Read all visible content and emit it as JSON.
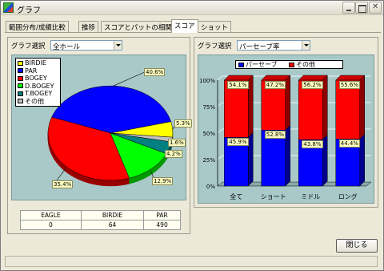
{
  "window": {
    "title": "グラフ"
  },
  "tabs": [
    {
      "label": "範囲分布/成績比較",
      "active": false
    },
    {
      "label": "推移",
      "active": false
    },
    {
      "label": "スコアとパットの相関",
      "active": false
    },
    {
      "label": "スコア",
      "active": true
    },
    {
      "label": "ショット",
      "active": false
    }
  ],
  "left_panel": {
    "select_label": "グラフ選択",
    "select_value": "全ホール"
  },
  "right_panel": {
    "select_label": "グラフ選択",
    "select_value": "パーセーブ率"
  },
  "score_table": {
    "headers": [
      "EAGLE",
      "BIRDIE",
      "PAR"
    ],
    "values": [
      "0",
      "64",
      "490"
    ]
  },
  "close_button": "閉じる",
  "chart_data": [
    {
      "type": "pie",
      "categories": [
        "BIRDIE",
        "PAR",
        "BOGEY",
        "D.BOGEY",
        "T.BOGEY",
        "その他"
      ],
      "values": [
        5.3,
        40.6,
        35.4,
        12.9,
        4.2,
        1.6
      ],
      "labels": [
        "5.3%",
        "40.6%",
        "35.4%",
        "12.9%",
        "4.2%",
        "1.6%"
      ],
      "colors": [
        "#ffff00",
        "#0000ff",
        "#ff0000",
        "#00ff00",
        "#008080",
        "#c0c0c0"
      ],
      "legend": "top-left"
    },
    {
      "type": "bar",
      "stacked": true,
      "categories": [
        "全て",
        "ショート",
        "ミドル",
        "ロング"
      ],
      "series": [
        {
          "name": "パーセーブ",
          "values": [
            45.9,
            52.8,
            43.8,
            44.4
          ],
          "labels": [
            "45.9%",
            "52.8%",
            "43.8%",
            "44.4%"
          ],
          "color": "#0000ff"
        },
        {
          "name": "その他",
          "values": [
            54.1,
            47.2,
            56.2,
            55.6
          ],
          "labels": [
            "54.1%",
            "47.2%",
            "56.2%",
            "55.6%"
          ],
          "color": "#ff0000"
        }
      ],
      "y_ticks": [
        "0%",
        "25%",
        "50%",
        "75%",
        "100%"
      ],
      "ylim": [
        0,
        100
      ],
      "legend": "top"
    }
  ]
}
